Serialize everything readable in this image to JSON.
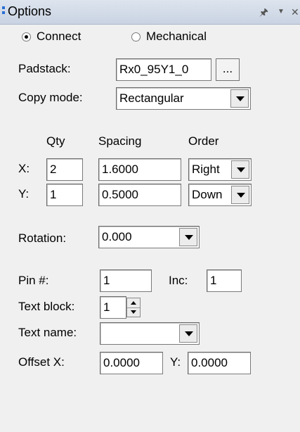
{
  "panel": {
    "title": "Options"
  },
  "mode": {
    "connect_label": "Connect",
    "mechanical_label": "Mechanical",
    "selected": "Connect"
  },
  "padstack": {
    "label": "Padstack:",
    "value": "Rx0_95Y1_0",
    "browse_label": "..."
  },
  "copy_mode": {
    "label": "Copy mode:",
    "value": "Rectangular"
  },
  "grid": {
    "qty_header": "Qty",
    "spacing_header": "Spacing",
    "order_header": "Order",
    "x": {
      "label": "X:",
      "qty": "2",
      "spacing": "1.6000",
      "order": "Right"
    },
    "y": {
      "label": "Y:",
      "qty": "1",
      "spacing": "0.5000",
      "order": "Down"
    }
  },
  "rotation": {
    "label": "Rotation:",
    "value": "0.000"
  },
  "pin": {
    "label": "Pin #:",
    "value": "1",
    "inc_label": "Inc:",
    "inc_value": "1"
  },
  "text_block": {
    "label": "Text block:",
    "value": "1"
  },
  "text_name": {
    "label": "Text name:",
    "value": ""
  },
  "offset": {
    "x_label": "Offset X:",
    "x_value": "0.0000",
    "y_label": "Y:",
    "y_value": "0.0000"
  },
  "icons": {
    "pin": "pushpin-icon",
    "menu": "dropdown-menu-icon",
    "close": "close-icon"
  }
}
